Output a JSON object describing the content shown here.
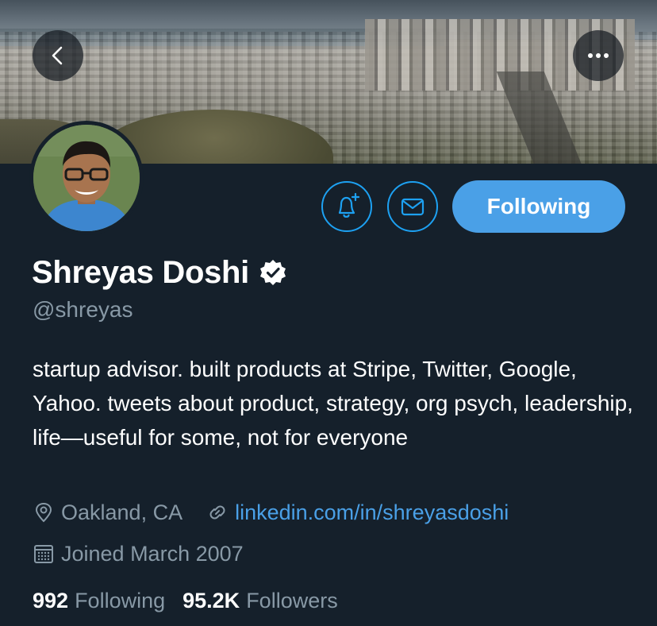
{
  "nav": {
    "back_icon": "chevron-left-icon",
    "more_icon": "ellipsis-icon"
  },
  "profile": {
    "name": "Shreyas Doshi",
    "handle": "@shreyas",
    "verified": true,
    "bio": "startup advisor. built products at Stripe, Twitter, Google, Yahoo. tweets about product, strategy, org psych, leadership, life—useful for some, not for everyone",
    "location": "Oakland, CA",
    "website": "linkedin.com/in/shreyasdoshi",
    "joined": "Joined March 2007"
  },
  "actions": {
    "notify_icon": "bell-plus-icon",
    "message_icon": "envelope-icon",
    "follow_label": "Following"
  },
  "stats": {
    "following_count": "992",
    "following_label": "Following",
    "followers_count": "95.2K",
    "followers_label": "Followers"
  },
  "colors": {
    "background": "#15202b",
    "accent": "#1da1f2",
    "button": "#4aa0e7",
    "muted_text": "#8899a6"
  }
}
